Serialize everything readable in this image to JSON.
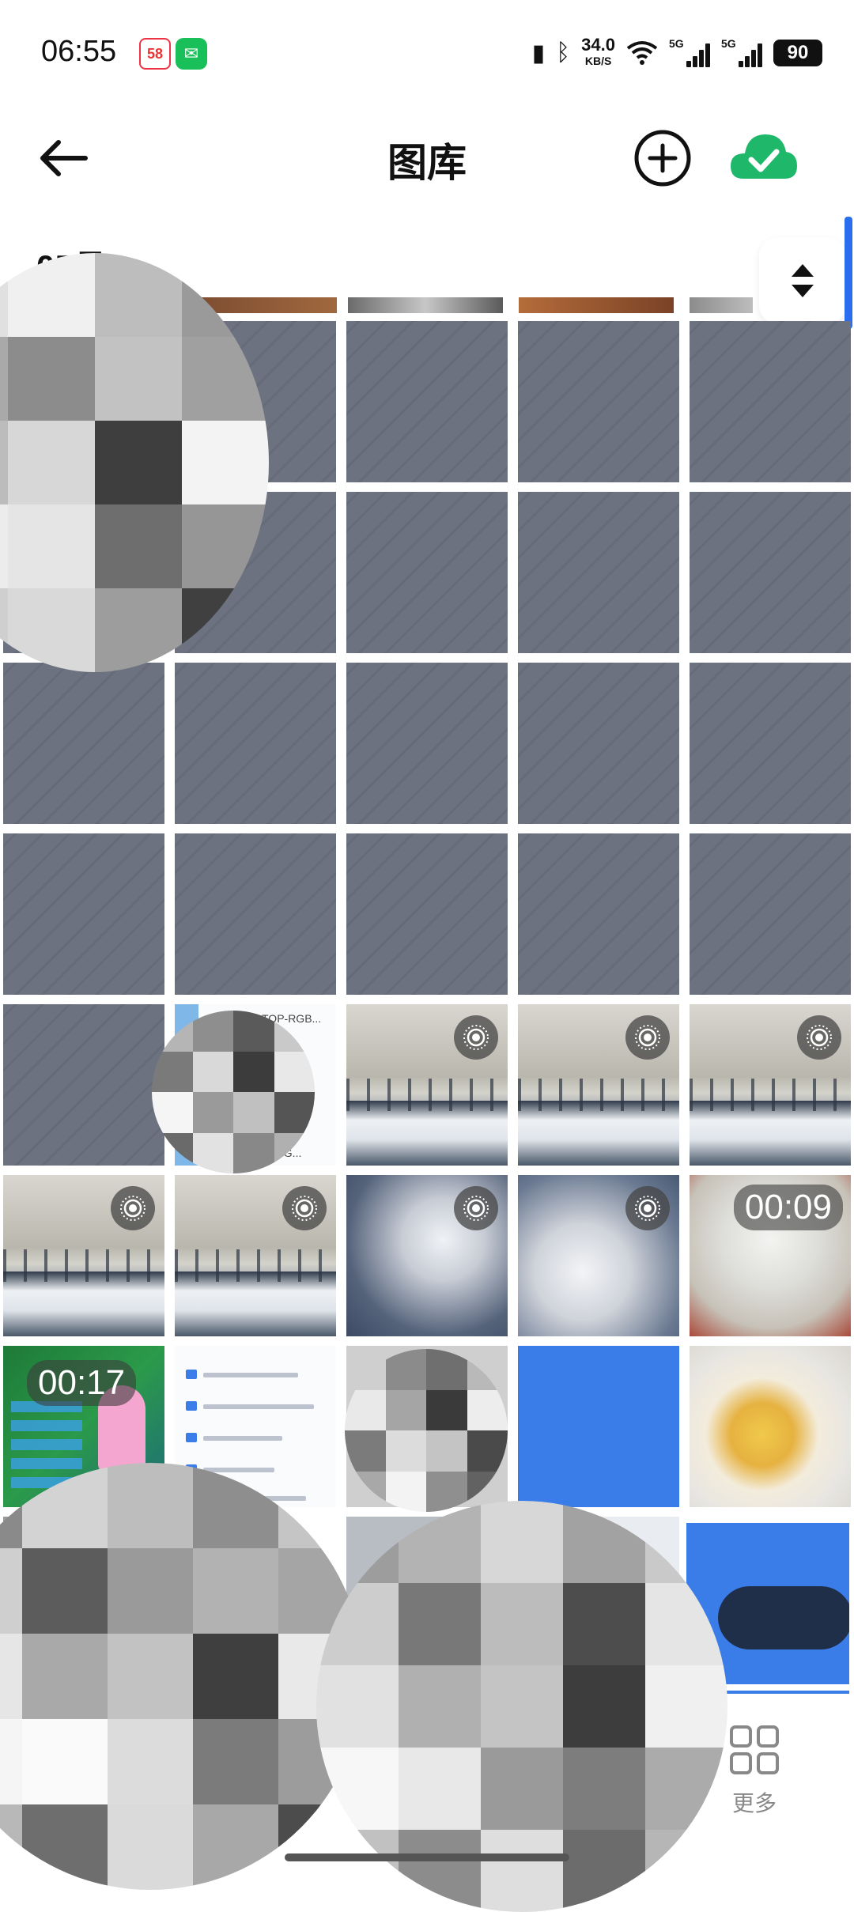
{
  "status_bar": {
    "time": "06:55",
    "app_58_label": "58",
    "net_speed_value": "34.0",
    "net_speed_unit": "KB/S",
    "signal_1_label": "5G",
    "signal_2_label": "5G",
    "battery": "90",
    "icons": [
      "app-58-icon",
      "wechat-icon",
      "vibrate-icon",
      "bluetooth-icon",
      "wifi-icon",
      "signal-icon",
      "battery-icon"
    ]
  },
  "header": {
    "title": "图库",
    "back_icon": "arrow-left-icon",
    "add_icon": "plus-circle-icon",
    "cloud_icon": "cloud-check-icon"
  },
  "month_header": {
    "label": "05月"
  },
  "grid": {
    "video_badges": [
      "00:09",
      "00:17"
    ],
    "live_badge_icon": "live-photo-icon",
    "partial_texts": [
      "TOP-RGB...",
      "9G..."
    ]
  },
  "bottom_nav": {
    "more_label": "更多",
    "more_icon": "grid-four-icon"
  },
  "colors": {
    "accent_blue": "#3a7de9",
    "cloud_green": "#1fb86a",
    "placeholder_gray": "#6c7280"
  }
}
